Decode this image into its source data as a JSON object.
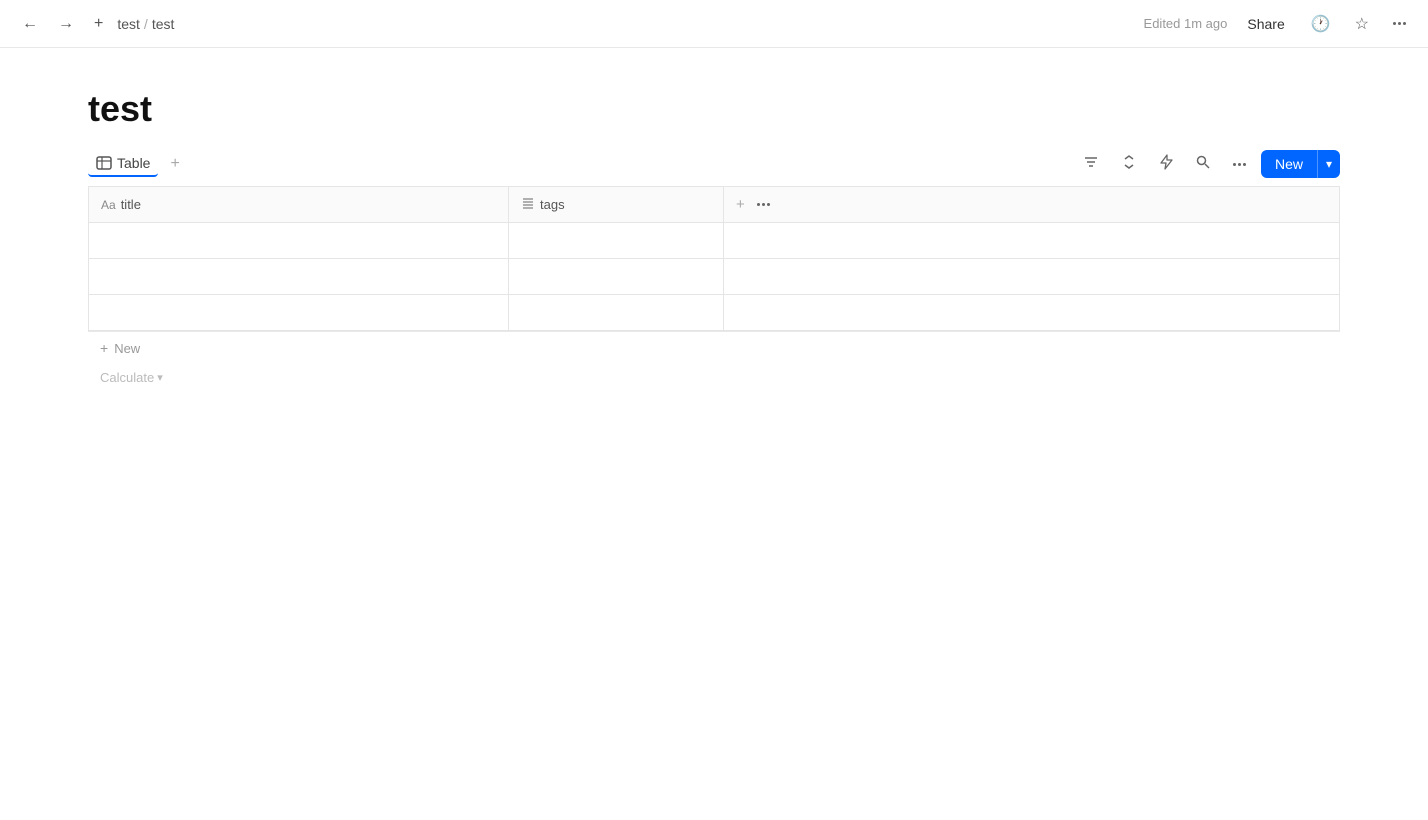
{
  "topbar": {
    "back_label": "←",
    "forward_label": "→",
    "new_tab_label": "+",
    "breadcrumb": [
      "test",
      "/",
      "test"
    ],
    "edited_text": "Edited 1m ago",
    "share_label": "Share",
    "history_icon": "🕐",
    "star_icon": "☆",
    "more_icon": "···"
  },
  "page": {
    "title": "test"
  },
  "view_toolbar": {
    "table_icon": "table",
    "table_label": "Table",
    "add_view_label": "+",
    "filter_icon": "≡",
    "sort_icon": "↕",
    "automation_icon": "⚡",
    "search_icon": "🔍",
    "more_icon": "···",
    "new_label": "New",
    "dropdown_icon": "▾"
  },
  "table": {
    "columns": [
      {
        "id": "title",
        "icon": "Aa",
        "label": "title"
      },
      {
        "id": "tags",
        "icon": "list",
        "label": "tags"
      },
      {
        "id": "add",
        "label": "+"
      }
    ],
    "rows": [
      {
        "id": 1,
        "title": "",
        "tags": ""
      },
      {
        "id": 2,
        "title": "",
        "tags": ""
      },
      {
        "id": 3,
        "title": "",
        "tags": ""
      }
    ]
  },
  "new_row": {
    "icon": "+",
    "label": "New"
  },
  "calculate": {
    "label": "Calculate",
    "icon": "▾"
  }
}
